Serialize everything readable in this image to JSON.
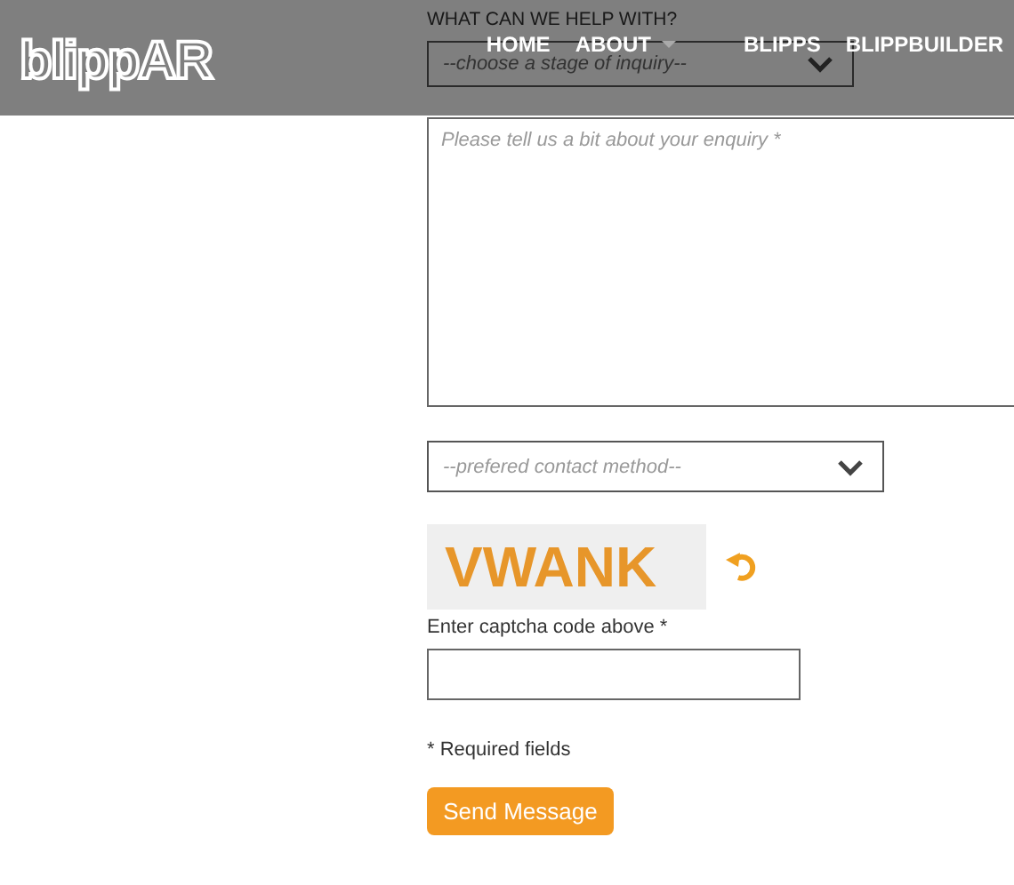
{
  "header": {
    "logo": "blippAR",
    "nav": [
      {
        "label": "HOME",
        "dropdown": false
      },
      {
        "label": "ABOUT",
        "dropdown": true
      },
      {
        "label": "BLIPPS",
        "dropdown": false
      },
      {
        "label": "BLIPPBUILDER",
        "dropdown": false
      }
    ]
  },
  "form": {
    "inquiry_label": "WHAT CAN WE HELP WITH?",
    "inquiry_select": {
      "placeholder": "--choose a stage of inquiry--"
    },
    "enquiry_text": {
      "placeholder": "Please tell us a bit about your enquiry *"
    },
    "contact_select": {
      "placeholder": "--prefered contact method--"
    },
    "captcha": {
      "code": "VWANK",
      "label": "Enter captcha code above *"
    },
    "required_note": "* Required fields",
    "submit": "Send Message"
  }
}
